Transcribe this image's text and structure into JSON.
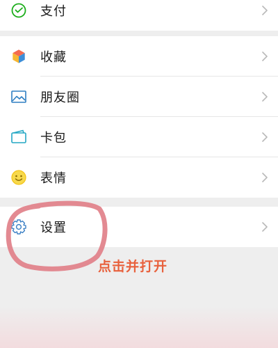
{
  "menu_group1": {
    "items": [
      {
        "label": "支付",
        "icon": "pay-icon"
      }
    ]
  },
  "menu_group2": {
    "items": [
      {
        "label": "收藏",
        "icon": "favorites-icon"
      },
      {
        "label": "朋友圈",
        "icon": "moments-icon"
      },
      {
        "label": "卡包",
        "icon": "card-wallet-icon"
      },
      {
        "label": "表情",
        "icon": "stickers-icon"
      }
    ]
  },
  "menu_group3": {
    "items": [
      {
        "label": "设置",
        "icon": "settings-icon"
      }
    ]
  },
  "annotation": {
    "text": "点击并打开",
    "color": "#e8613d",
    "circle_color": "#e07d86"
  },
  "colors": {
    "background": "#eeeeee",
    "card": "#ffffff",
    "pay_icon": "#1aad19",
    "moments_icon": "#2e7fc2",
    "card_icon": "#23a7c4",
    "sticker_icon": "#f3c316",
    "settings_icon": "#3b7fc4"
  }
}
